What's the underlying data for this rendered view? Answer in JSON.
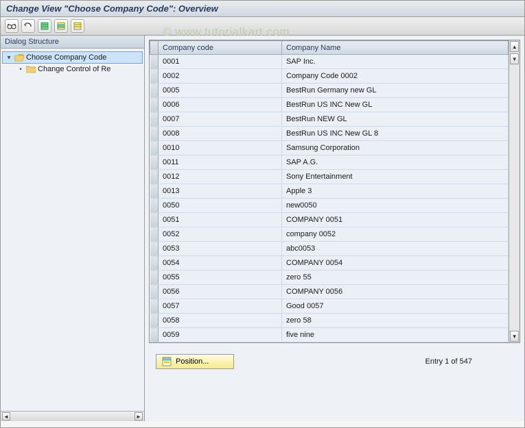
{
  "title": "Change View \"Choose Company Code\": Overview",
  "watermark": "© www.tutorialkart.com",
  "toolbar": {
    "btn_display": "👓",
    "btn_undo": "↩",
    "btn_select_all": "▥",
    "btn_select_block": "▥",
    "btn_deselect": "▥"
  },
  "sidebar": {
    "header": "Dialog Structure",
    "node1": {
      "toggle": "▾",
      "label": "Choose Company Code"
    },
    "node2": {
      "toggle": "•",
      "label": "Change Control of Re"
    }
  },
  "table": {
    "headers": {
      "code": "Company code",
      "name": "Company Name"
    },
    "rows": [
      {
        "code": "0001",
        "name": "SAP Inc."
      },
      {
        "code": "0002",
        "name": "Company Code 0002"
      },
      {
        "code": "0005",
        "name": "BestRun Germany new GL"
      },
      {
        "code": "0006",
        "name": "BestRun US INC New GL"
      },
      {
        "code": "0007",
        "name": "BestRun NEW GL"
      },
      {
        "code": "0008",
        "name": "BestRun US INC New GL 8"
      },
      {
        "code": "0010",
        "name": "Samsung Corporation"
      },
      {
        "code": "0011",
        "name": "SAP A.G."
      },
      {
        "code": "0012",
        "name": "Sony Entertainment"
      },
      {
        "code": "0013",
        "name": "Apple 3"
      },
      {
        "code": "0050",
        "name": "new0050"
      },
      {
        "code": "0051",
        "name": "COMPANY 0051"
      },
      {
        "code": "0052",
        "name": "company 0052"
      },
      {
        "code": "0053",
        "name": "abc0053"
      },
      {
        "code": "0054",
        "name": "COMPANY 0054"
      },
      {
        "code": "0055",
        "name": "zero 55"
      },
      {
        "code": "0056",
        "name": "COMPANY 0056"
      },
      {
        "code": "0057",
        "name": "Good 0057"
      },
      {
        "code": "0058",
        "name": "zero 58"
      },
      {
        "code": "0059",
        "name": "five nine"
      }
    ]
  },
  "bottom": {
    "position_label": "Position...",
    "entry_status": "Entry 1 of 547"
  }
}
